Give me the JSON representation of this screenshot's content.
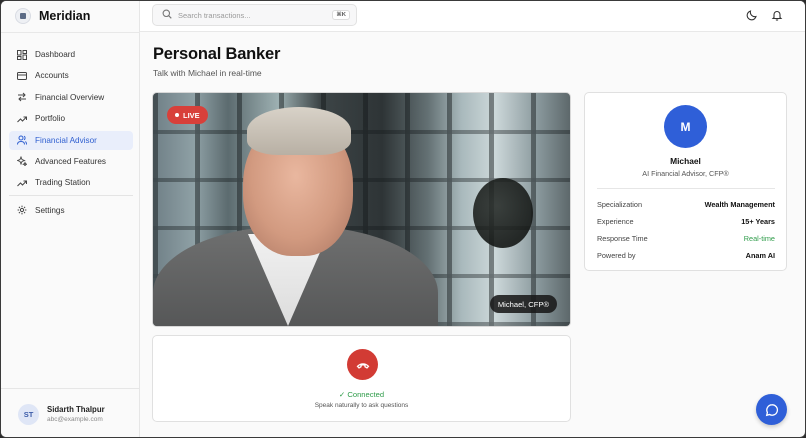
{
  "app": {
    "name": "Meridian"
  },
  "search": {
    "placeholder": "Search transactions...",
    "shortcut": "⌘K"
  },
  "sidebar": {
    "items": [
      {
        "label": "Dashboard",
        "icon": "grid-icon"
      },
      {
        "label": "Accounts",
        "icon": "credit-card-icon"
      },
      {
        "label": "Financial Overview",
        "icon": "arrows-icon"
      },
      {
        "label": "Portfolio",
        "icon": "trend-up-icon"
      },
      {
        "label": "Financial Advisor",
        "icon": "users-icon",
        "active": true
      },
      {
        "label": "Advanced Features",
        "icon": "sparkles-icon"
      },
      {
        "label": "Trading Station",
        "icon": "trend-up-icon"
      }
    ],
    "settings": {
      "label": "Settings",
      "icon": "gear-icon"
    }
  },
  "user": {
    "initials": "ST",
    "name": "Sidarth Thalpur",
    "email": "abc@example.com"
  },
  "page": {
    "title": "Personal Banker",
    "subtitle": "Talk with Michael in real-time"
  },
  "video": {
    "live_label": "LIVE",
    "name_tag": "Michael, CFP®"
  },
  "call": {
    "status": "✓ Connected",
    "hint": "Speak naturally to ask questions"
  },
  "advisor": {
    "initial": "M",
    "name": "Michael",
    "role": "AI Financial Advisor, CFP®",
    "details": [
      {
        "key": "Specialization",
        "value": "Wealth Management"
      },
      {
        "key": "Experience",
        "value": "15+ Years"
      },
      {
        "key": "Response Time",
        "value": "Real-time"
      },
      {
        "key": "Powered by",
        "value": "Anam AI"
      }
    ]
  },
  "colors": {
    "accent": "#2f5fd8",
    "live": "#d8403a",
    "success": "#2f9c4a",
    "end_call": "#d23b34"
  }
}
